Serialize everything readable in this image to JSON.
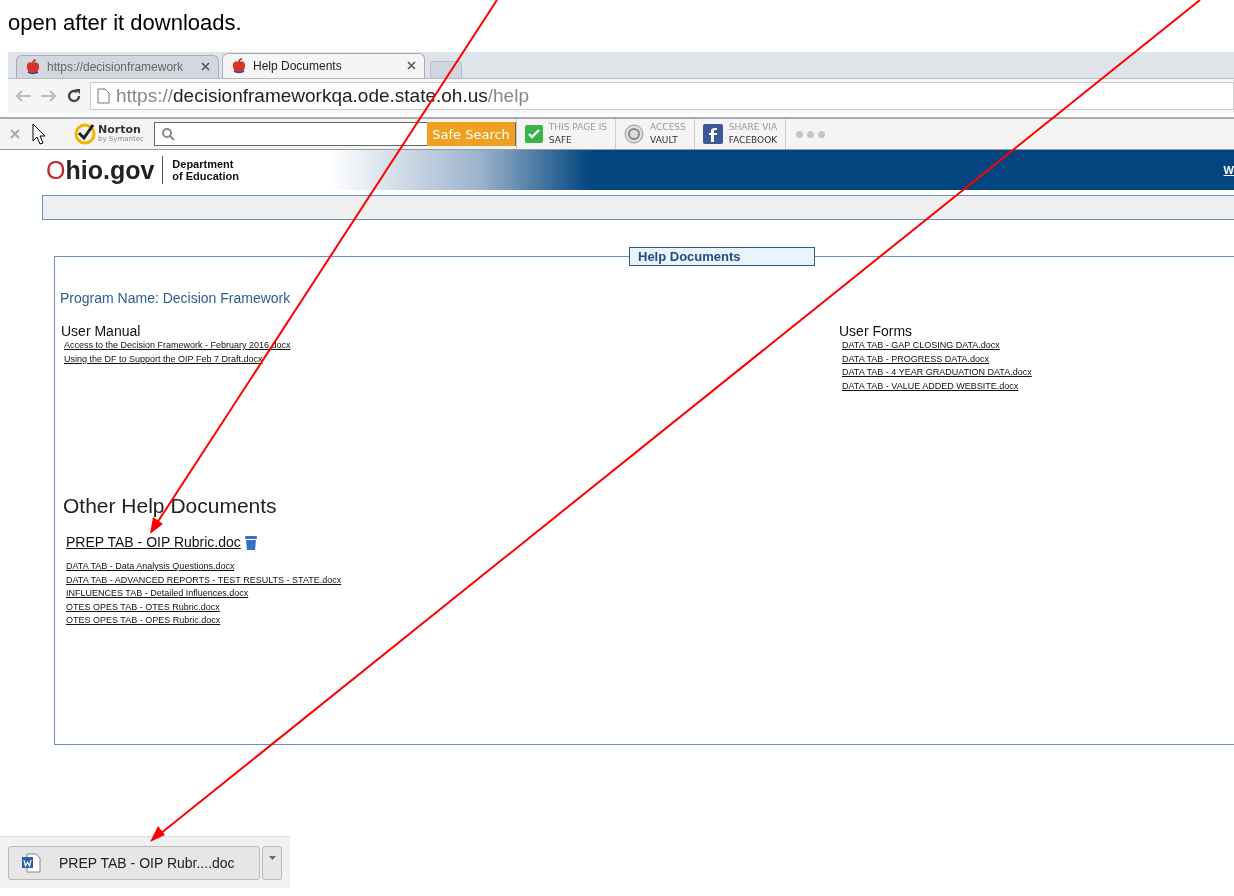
{
  "caption": "open after it downloads.",
  "tabs": [
    {
      "label": "https://decisionframework",
      "selected": false
    },
    {
      "label": "Help Documents",
      "selected": true
    }
  ],
  "address": {
    "scheme": "https://",
    "host": "decisionframeworkqa.ode.state.oh.us",
    "path": "/help"
  },
  "toolbar": {
    "brand": "Norton",
    "brand_sub": "by Symantec",
    "search_button": "Safe Search",
    "status": [
      "THIS PAGE IS",
      "SAFE"
    ],
    "vault": [
      "ACCESS",
      "VAULT"
    ],
    "share": [
      "SHARE VIA",
      "FACEBOOK"
    ]
  },
  "banner": {
    "logo_initial": "O",
    "logo_rest": "hio.gov",
    "department": [
      "Department",
      "of Education"
    ],
    "corner_link": "W"
  },
  "panel": {
    "legend": "Help Documents",
    "program": "Program Name: Decision Framework",
    "user_manual": {
      "title": "User Manual",
      "links": [
        "Access to the Decision Framework - February 2016.docx",
        "Using the DF to Support the OIP Feb 7 Draft.docx"
      ]
    },
    "user_forms": {
      "title": "User Forms",
      "links": [
        "DATA TAB - GAP CLOSING DATA.docx",
        "DATA TAB - PROGRESS DATA.docx",
        "DATA TAB - 4 YEAR GRADUATION DATA.docx",
        "DATA TAB - VALUE ADDED WEBSITE.docx"
      ]
    },
    "other": {
      "title": "Other Help Documents",
      "dragged": "PREP TAB - OIP Rubric.doc",
      "links": [
        "DATA TAB - Data Analysis Questions.docx",
        "DATA TAB - ADVANCED REPORTS - TEST RESULTS - STATE.docx",
        "INFLUENCES TAB - Detailed Influences.docx",
        "OTES OPES TAB - OTES Rubric.docx",
        "OTES OPES TAB - OPES Rubric.docx"
      ]
    }
  },
  "download": {
    "file": "PREP TAB - OIP Rubr....doc"
  }
}
